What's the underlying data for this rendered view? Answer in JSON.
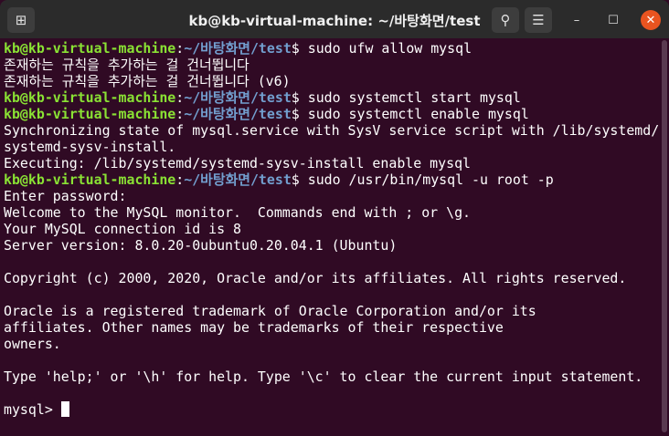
{
  "window": {
    "title": "kb@kb-virtual-machine: ~/바탕화면/test",
    "icons": [
      "new-tab-icon",
      "search-icon",
      "menu-icon",
      "minimize-icon",
      "maximize-icon",
      "close-icon"
    ]
  },
  "prompt": {
    "user": "kb@kb-virtual-machine",
    "sep": ":",
    "path": "~/바탕화면/test",
    "dollar": "$ "
  },
  "lines": [
    {
      "type": "prompt",
      "cmd": "sudo ufw allow mysql"
    },
    {
      "type": "text",
      "text": "존재하는 규칙을 추가하는 걸 건너뜁니다"
    },
    {
      "type": "text",
      "text": "존재하는 규칙을 추가하는 걸 건너뜁니다 (v6)"
    },
    {
      "type": "prompt",
      "cmd": "sudo systemctl start mysql"
    },
    {
      "type": "prompt",
      "cmd": "sudo systemctl enable mysql"
    },
    {
      "type": "text",
      "text": "Synchronizing state of mysql.service with SysV service script with /lib/systemd/"
    },
    {
      "type": "text",
      "text": "systemd-sysv-install."
    },
    {
      "type": "text",
      "text": "Executing: /lib/systemd/systemd-sysv-install enable mysql"
    },
    {
      "type": "prompt",
      "cmd": "sudo /usr/bin/mysql -u root -p"
    },
    {
      "type": "text",
      "text": "Enter password:"
    },
    {
      "type": "text",
      "text": "Welcome to the MySQL monitor.  Commands end with ; or \\g."
    },
    {
      "type": "text",
      "text": "Your MySQL connection id is 8"
    },
    {
      "type": "text",
      "text": "Server version: 8.0.20-0ubuntu0.20.04.1 (Ubuntu)"
    },
    {
      "type": "text",
      "text": ""
    },
    {
      "type": "text",
      "text": "Copyright (c) 2000, 2020, Oracle and/or its affiliates. All rights reserved."
    },
    {
      "type": "text",
      "text": ""
    },
    {
      "type": "text",
      "text": "Oracle is a registered trademark of Oracle Corporation and/or its"
    },
    {
      "type": "text",
      "text": "affiliates. Other names may be trademarks of their respective"
    },
    {
      "type": "text",
      "text": "owners."
    },
    {
      "type": "text",
      "text": ""
    },
    {
      "type": "text",
      "text": "Type 'help;' or '\\h' for help. Type '\\c' to clear the current input statement."
    },
    {
      "type": "text",
      "text": ""
    },
    {
      "type": "mysql",
      "text": "mysql> "
    }
  ],
  "colors": {
    "background": "#300a24",
    "user": "#8ae234",
    "path": "#729fcf"
  }
}
